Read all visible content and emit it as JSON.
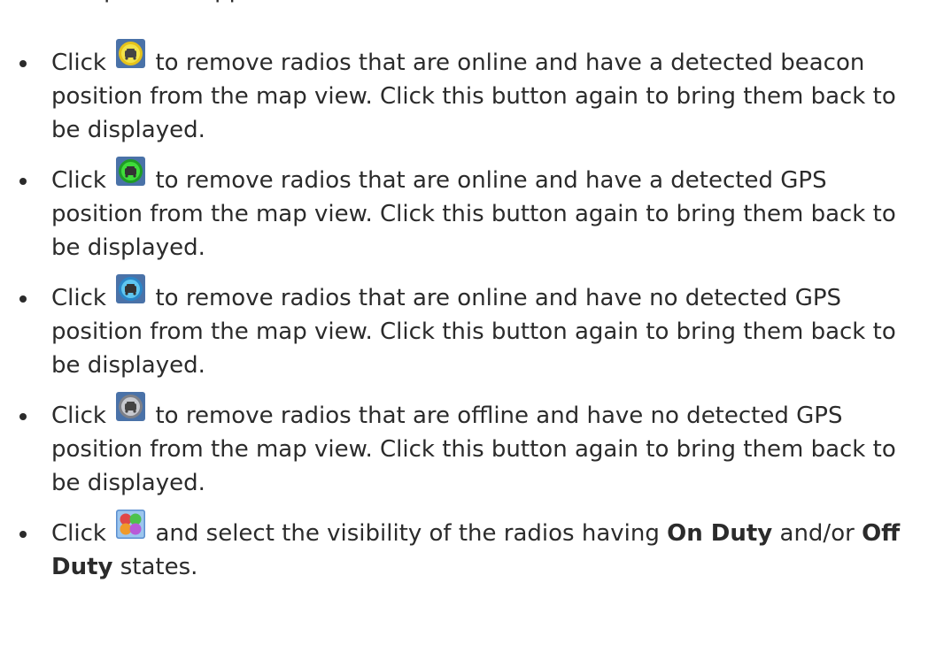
{
  "partial_text": "... top of the app...",
  "bullets": [
    {
      "click": "Click",
      "icon": "yellow-radio-icon",
      "text": "to remove radios that are online and have a detected beacon position from the map view. Click this button again to bring them back to be displayed.",
      "ring": "#e6c21a",
      "core": "#f2e34a"
    },
    {
      "click": "Click",
      "icon": "green-radio-icon",
      "text": "to remove radios that are online and have a detected GPS position from the map view. Click this button again to bring them back to be displayed.",
      "ring": "#1f9c25",
      "core": "#3fdc3a"
    },
    {
      "click": "Click",
      "icon": "blue-radio-icon",
      "text": "to remove radios that are online and have no detected GPS position from the map view. Click this button again to bring them back to be displayed.",
      "ring": "#2a86c8",
      "core": "#5ec6f0"
    },
    {
      "click": "Click",
      "icon": "gray-radio-icon",
      "text": "to remove radios that are offline and have no detected GPS position from the map view. Click this button again to bring them back to be displayed.",
      "ring": "#7d8088",
      "core": "#c7c9cf"
    },
    {
      "click": "Click",
      "icon": "duty-state-icon",
      "text_before": "and select the visibility of the radios having",
      "bold1": "On Duty",
      "mid": "and/or",
      "bold2": "Off Duty",
      "after": "states."
    }
  ],
  "colors": {
    "icon_bg": "#4a72a8",
    "text": "#2b2b2b"
  }
}
